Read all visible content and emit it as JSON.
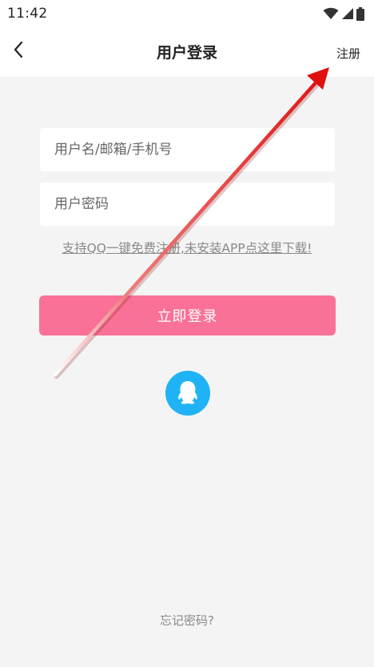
{
  "status_bar": {
    "time": "11:42"
  },
  "header": {
    "title": "用户登录",
    "register_label": "注册",
    "back_icon": "chevron-left-icon"
  },
  "form": {
    "username_placeholder": "用户名/邮箱/手机号",
    "username_value": "",
    "password_placeholder": "用户密码",
    "password_value": "",
    "qq_promo_text": "支持QQ一键免费注册,未安装APP点这里下载!",
    "login_button_label": "立即登录",
    "qq_login_icon": "qq-penguin-icon",
    "forgot_password_label": "忘记密码?"
  },
  "colors": {
    "accent": "#f97196",
    "qq_blue": "#1fb3f5",
    "annotation_arrow": "#e01010"
  }
}
